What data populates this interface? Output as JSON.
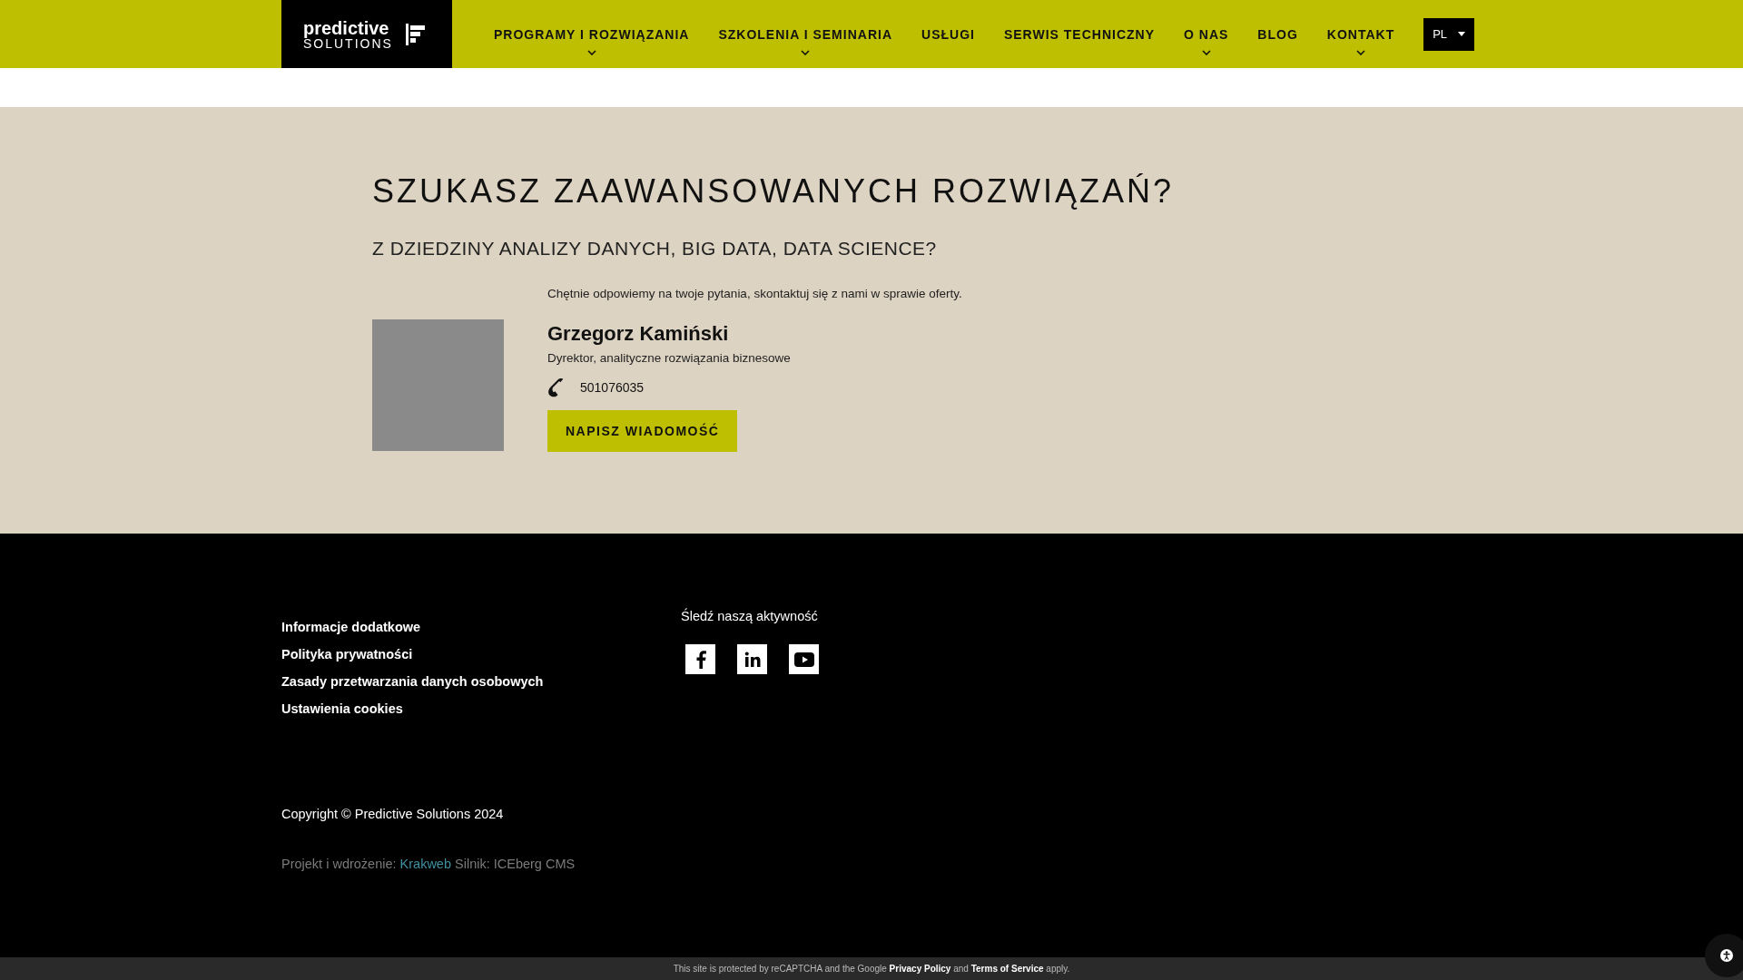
{
  "header": {
    "logo": {
      "line1": "predictive",
      "line2": "SOLUTIONS"
    },
    "nav": [
      {
        "label": "PROGRAMY I ROZWIĄZANIA",
        "has_dropdown": true
      },
      {
        "label": "SZKOLENIA I SEMINARIA",
        "has_dropdown": true
      },
      {
        "label": "USŁUGI",
        "has_dropdown": false
      },
      {
        "label": "SERWIS TECHNICZNY",
        "has_dropdown": false
      },
      {
        "label": "O NAS",
        "has_dropdown": true
      },
      {
        "label": "BLOG",
        "has_dropdown": false
      },
      {
        "label": "KONTAKT",
        "has_dropdown": true
      }
    ],
    "language": "PL"
  },
  "hero": {
    "heading": "SZUKASZ ZAAWANSOWANYCH ROZWIĄZAŃ?",
    "subheading": "Z DZIEDZINY ANALIZY DANYCH, BIG DATA, DATA SCIENCE?",
    "intro": "Chętnie odpowiemy na twoje pytania, skontaktuj się z nami w sprawie oferty.",
    "contact": {
      "name": "Grzegorz Kamiński",
      "role": "Dyrektor, analityczne rozwiązania biznesowe",
      "phone": "501076035"
    },
    "button": "NAPISZ WIADOMOŚĆ"
  },
  "footer": {
    "links": [
      "Informacje dodatkowe",
      "Polityka prywatności",
      "Zasady przetwarzania danych osobowych",
      "Ustawienia cookies"
    ],
    "social": {
      "title": "Śledź naszą aktywność",
      "networks": [
        {
          "kind": "facebook"
        },
        {
          "kind": "linkedin"
        },
        {
          "kind": "youtube"
        }
      ]
    },
    "copyright": "Copyright © Predictive Solutions 2024",
    "credits": {
      "prefix": "Projekt i wdrożenie:",
      "link": "Krakweb",
      "suffix": "Silnik: ICEberg CMS"
    }
  },
  "recaptcha": {
    "before": "This site is protected by reCAPTCHA and the Google",
    "privacy": "Privacy Policy",
    "middle": "and",
    "terms": "Terms of Service",
    "after": "apply."
  }
}
